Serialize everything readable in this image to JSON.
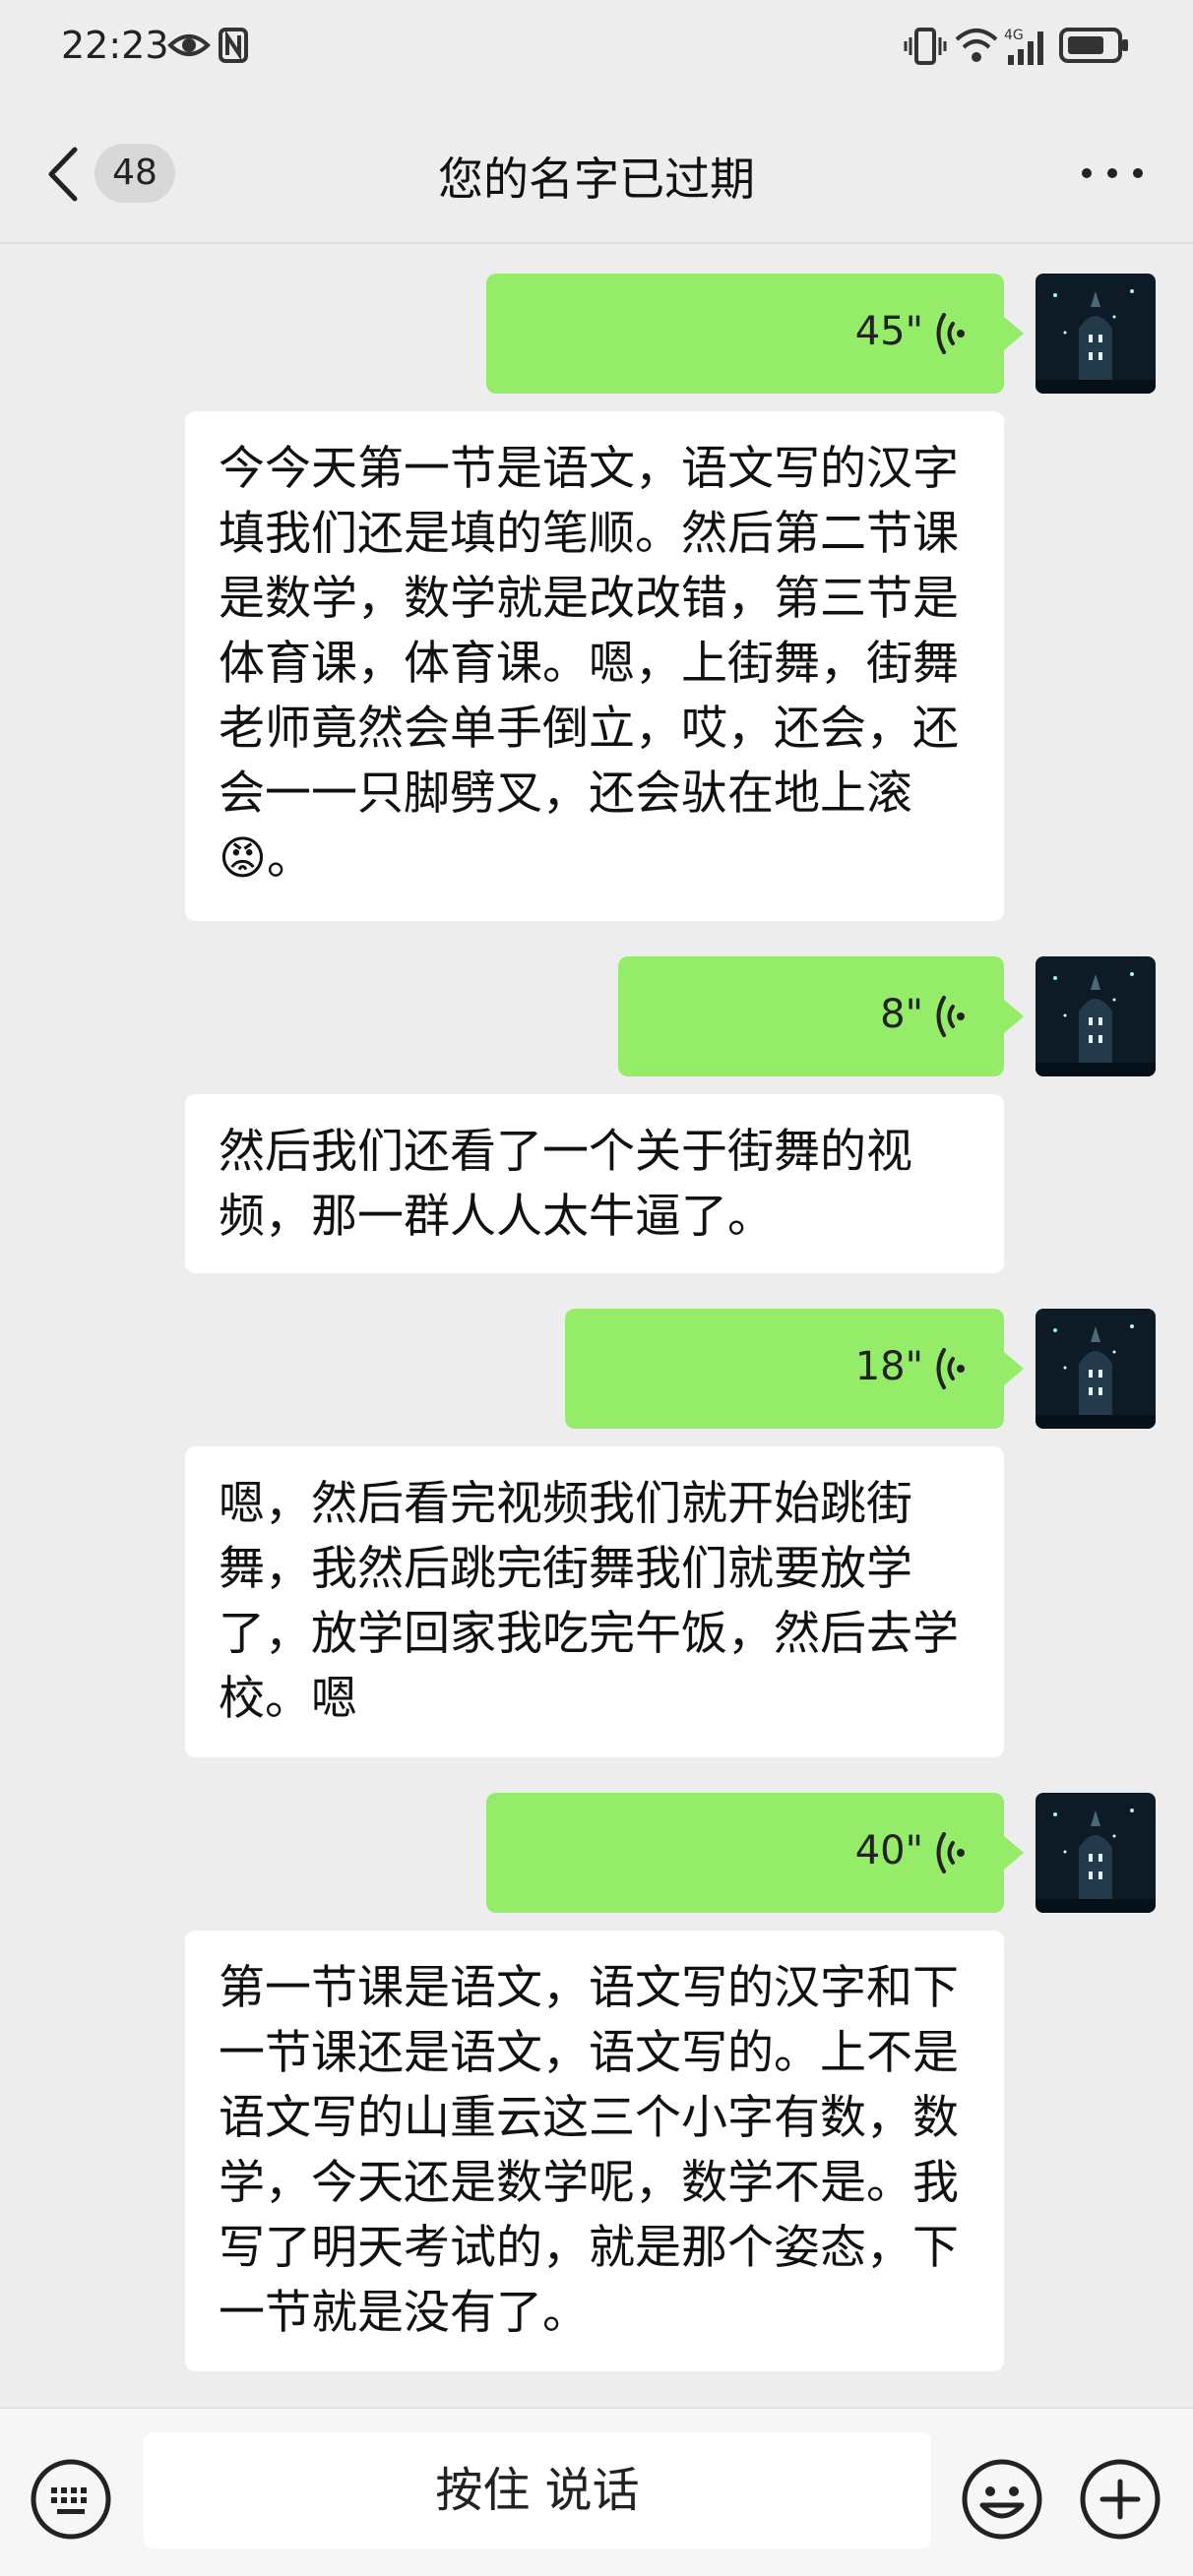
{
  "status_bar": {
    "time": "22:23"
  },
  "header": {
    "back_count": "48",
    "title": "您的名字已过期"
  },
  "messages": [
    {
      "voice_duration": "45\"",
      "transcript": "今今天第一节是语文，语文写的汉字填我们还是填的笔顺。然后第二节课是数学，数学就是改改错，第三节是体育课，体育课。嗯，上街舞，街舞老师竟然会单手倒立，哎，还会，还会一一只脚劈叉，还会驮在地上滚😡。"
    },
    {
      "voice_duration": "8\"",
      "transcript": "然后我们还看了一个关于街舞的视频，那一群人人太牛逼了。"
    },
    {
      "voice_duration": "18\"",
      "transcript": "嗯，然后看完视频我们就开始跳街舞，我然后跳完街舞我们就要放学了，放学回家我吃完午饭，然后去学校。嗯"
    },
    {
      "voice_duration": "40\"",
      "transcript": "第一节课是语文，语文写的汉字和下一节课还是语文，语文写的。上不是语文写的山重云这三个小字有数，数学，今天还是数学呢，数学不是。我写了明天考试的，就是那个姿态，下一节就是没有了。"
    }
  ],
  "bottom_bar": {
    "hold_to_talk": "按住 说话"
  },
  "colors": {
    "voice_bubble": "#95ec69",
    "background": "#ededed"
  }
}
